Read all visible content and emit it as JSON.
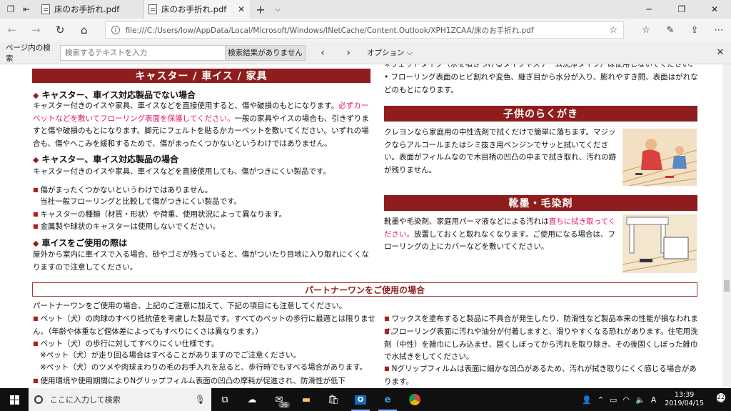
{
  "tabs": [
    {
      "title": "床のお手折れ.pdf"
    },
    {
      "title": "床のお手折れ.pdf"
    }
  ],
  "address": {
    "url": "file:///C:/Users/low/AppData/Local/Microsoft/Windows/INetCache/Content.Outlook/XPH1ZCAA/床のお手折れ.pdf"
  },
  "findbar": {
    "label": "ページ内の検索",
    "placeholder": "検索するテキストを入力",
    "status": "検索結果がありません",
    "options": "オプション"
  },
  "left": {
    "band": "キャスター / 車イス / 家具",
    "h1": "キャスター、車イス対応製品でない場合",
    "p1_a": "キャスター付きのイスや家具、車イスなどを直接使用すると、傷や破損のもとになります。",
    "p1_pink": "必ずカーペットなどを敷いてフローリング表面を保護してください。",
    "p1_b": "一般の家具やイスの場合も、引きずりますと傷や破損のもとになります。脚元にフェルトを貼るかカーペットを敷いてください。いずれの場合も、傷やへこみを緩和するためで、傷がまったくつかないというわけではありません。",
    "h2": "キャスター、車イス対応製品の場合",
    "p2": "キャスター付きのイスや家具、車イスなどを直接使用しても、傷がつきにくい製品です。",
    "b1": "傷がまったくつかないというわけではありません。",
    "b1_sub": "当社一般フローリングと比較して傷がつきにくい製品です。",
    "b2": "キャスターの種類（材質・形状）や荷重、使用状況によって異なります。",
    "b3": "金属製や球状のキャスターは使用しないでください。",
    "h3": "車イスをご使用の際は",
    "p3": "屋外から室内に車イスで入る場合、砂やゴミが残っていると、傷がついたり目地に入り取れにくくなりますので注意してください。"
  },
  "right": {
    "top_cut": "※ウェットタイプ（水を噴きつけるタイプやスチーム洗浄タイプ）は使用しないでください。",
    "top_bullet": "フローリング表面のヒビ割れや変色、継ぎ目から水分が入り、膨れやすき問、表面はがれなどのもとになります。",
    "band2": "子供のらくがき",
    "p_child": "クレヨンなら家庭用の中性洗剤で拭くだけで簡単に落ちます。マジックならアルコールまたはシミ抜き用ベンジンでサッと拭いてください。表面がフィルムなので木目柄の凹凸の中まで拭き取れ、汚れの跡が残りません。",
    "band3": "靴墨・毛染剤",
    "p_shoe_a": "靴墨や毛染剤、家庭用パーマ液などによる汚れは",
    "p_shoe_pink": "直ちに拭き取ってください。",
    "p_shoe_b": "放置しておくと取れなくなります。ご使用になる場合は、フローリングの上にカバーなどを敷いてください。"
  },
  "partner": {
    "heading": "パートナーワンをご使用の場合",
    "intro": "パートナーワンをご使用の場合、上記のご注意に加えて、下記の項目にも注意してください。",
    "l1": "ペット（犬）の肉球のすべり抵抗値を考慮した製品です。すべてのペットの歩行に最適とは限りません。（年齢や体重など個体差によってもすべりにくさは異なります。）",
    "l2": "ペット（犬）の歩行に対してすべりにくい仕様です。",
    "l2_s1": "※ペット（犬）が走り回る場合はすべることがありますのでご注意ください。",
    "l2_s2": "※ペット（犬）のツメや肉球まわりの毛のお手入れを怠ると、歩行時でもすべる場合があります。",
    "l3": "使用環境や使用期間によりNグリップフィルム表面の凹凸の摩耗が促進され、防滑性が低下",
    "r1": "ワックスを塗布すると製品に不具合が発生したり、防滑性など製品本来の性能が損なわれます。",
    "r2": "フローリング表面に汚れや油分が付着しますと、滑りやすくなる恐れがあります。住宅用洗剤（中性）を雑巾にしみ込ませ、固くしぼってから汚れを取り除き、その後固くしぼった雑巾で水拭きをしてください。",
    "r3": "Nグリップフィルムは表面に細かな凹凸があるため、汚れが拭き取りにくく感じる場合があります。"
  },
  "taskbar": {
    "search": "ここに入力して検索",
    "badge": "36",
    "time": "13:39",
    "date": "2019/04/15",
    "notif": "22"
  }
}
